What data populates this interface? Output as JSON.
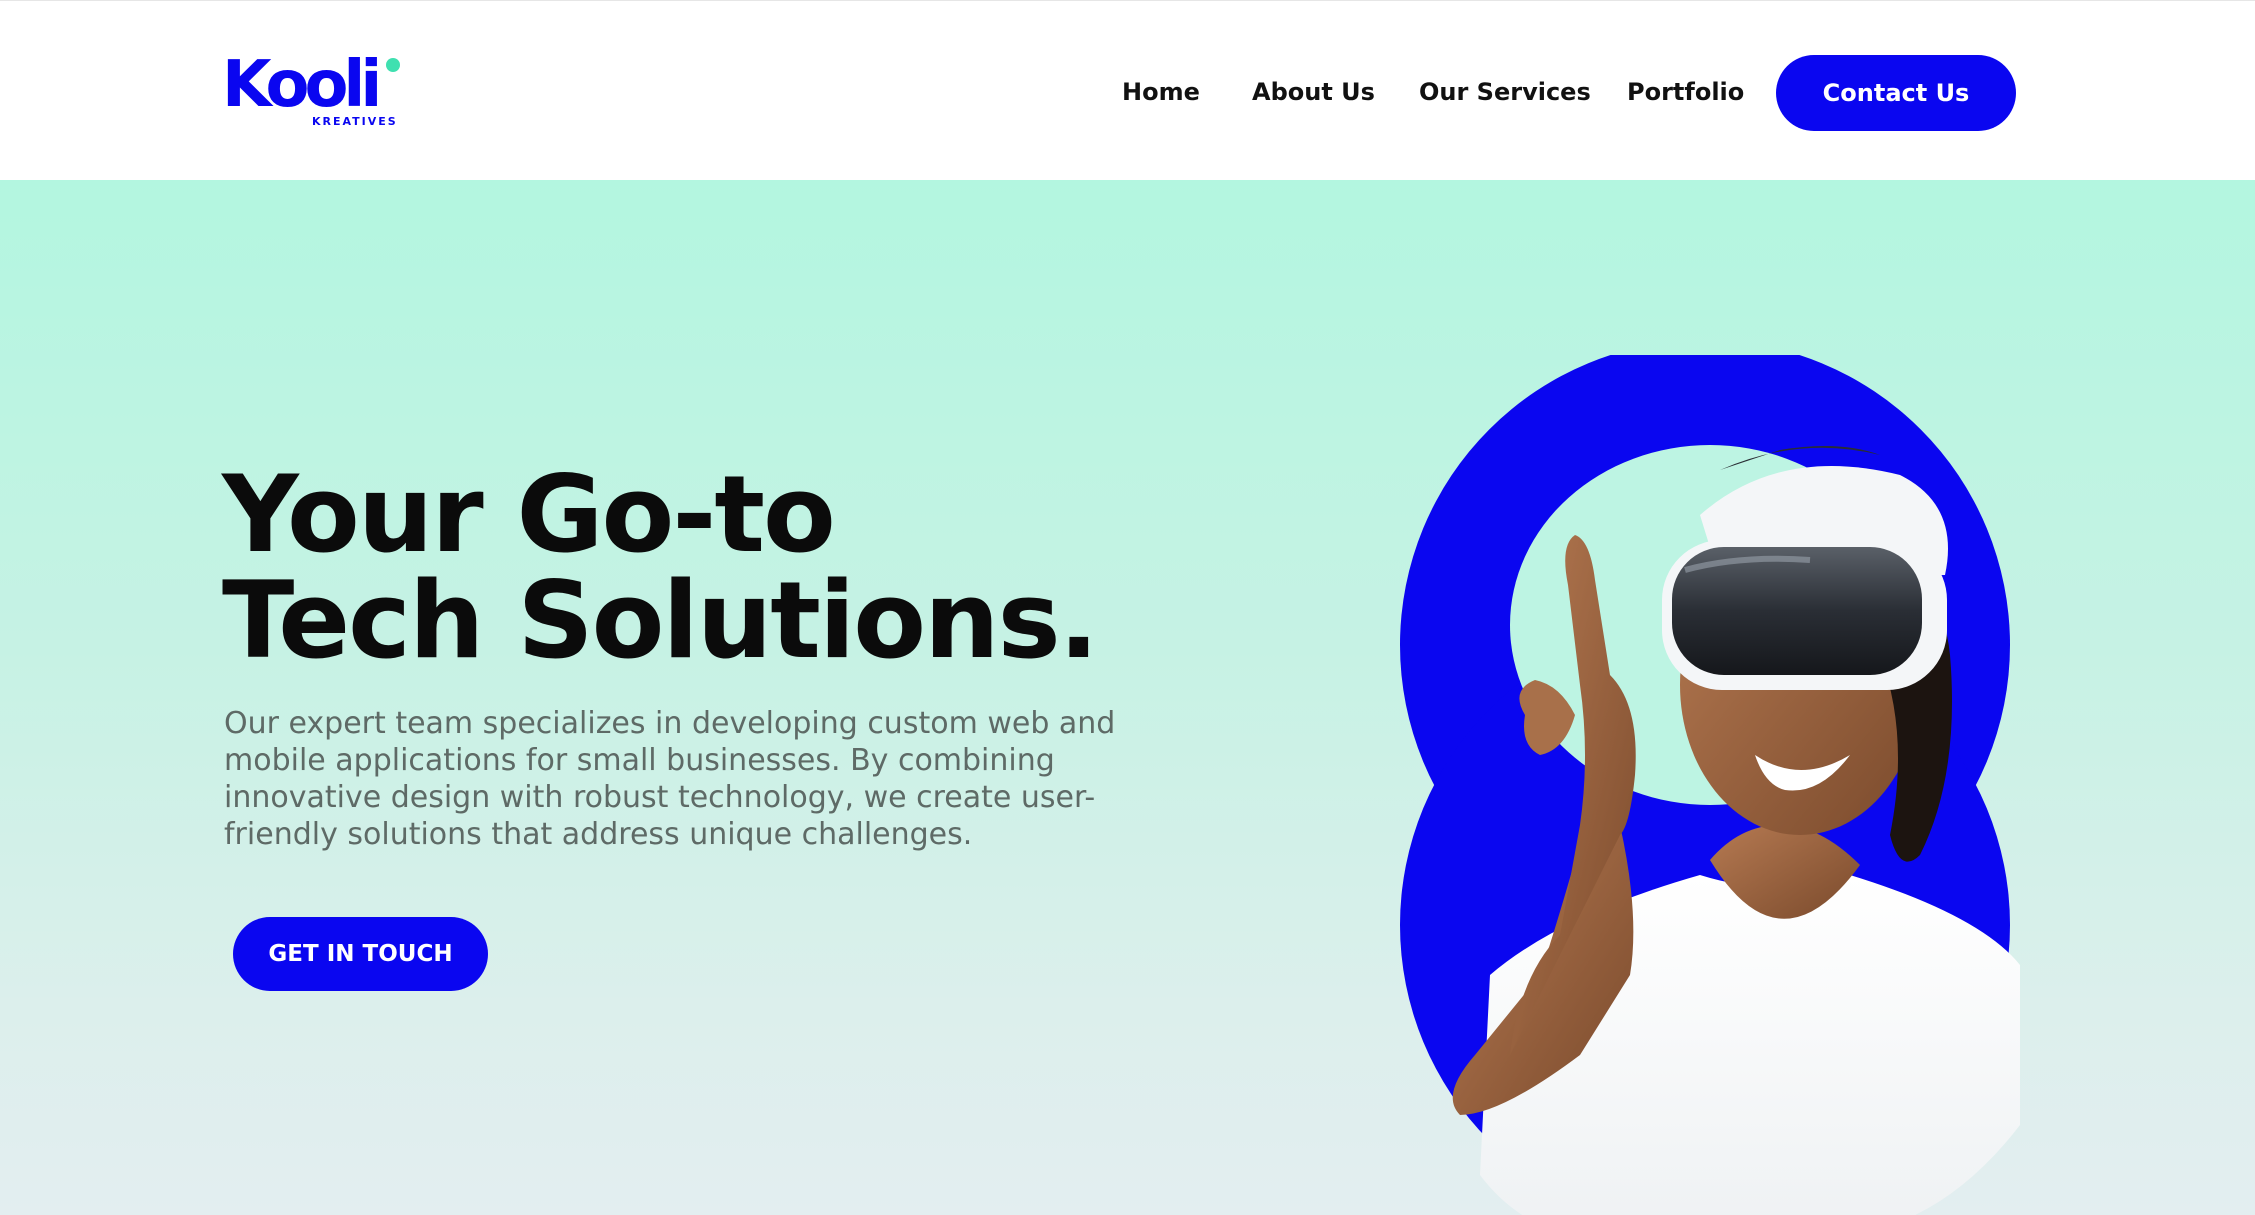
{
  "brand": {
    "name": "Kooli",
    "tagline": "KREATIVES",
    "primary_color": "#0a06f0",
    "accent_color": "#3fe0b0"
  },
  "nav": {
    "items": [
      {
        "label": "Home"
      },
      {
        "label": "About Us"
      },
      {
        "label": "Our Services"
      },
      {
        "label": "Portfolio"
      }
    ],
    "cta_label": "Contact Us"
  },
  "hero": {
    "title_line1": "Your Go-to",
    "title_line2": "Tech Solutions.",
    "description": "Our expert team specializes in developing custom web and mobile applications for small businesses. By combining innovative design with robust technology, we create user-friendly solutions that address unique challenges.",
    "cta_label": "GET IN TOUCH",
    "background_top": "#b3f6e0",
    "background_bottom": "#e3eef0",
    "image_subject": "woman-wearing-vr-headset"
  }
}
